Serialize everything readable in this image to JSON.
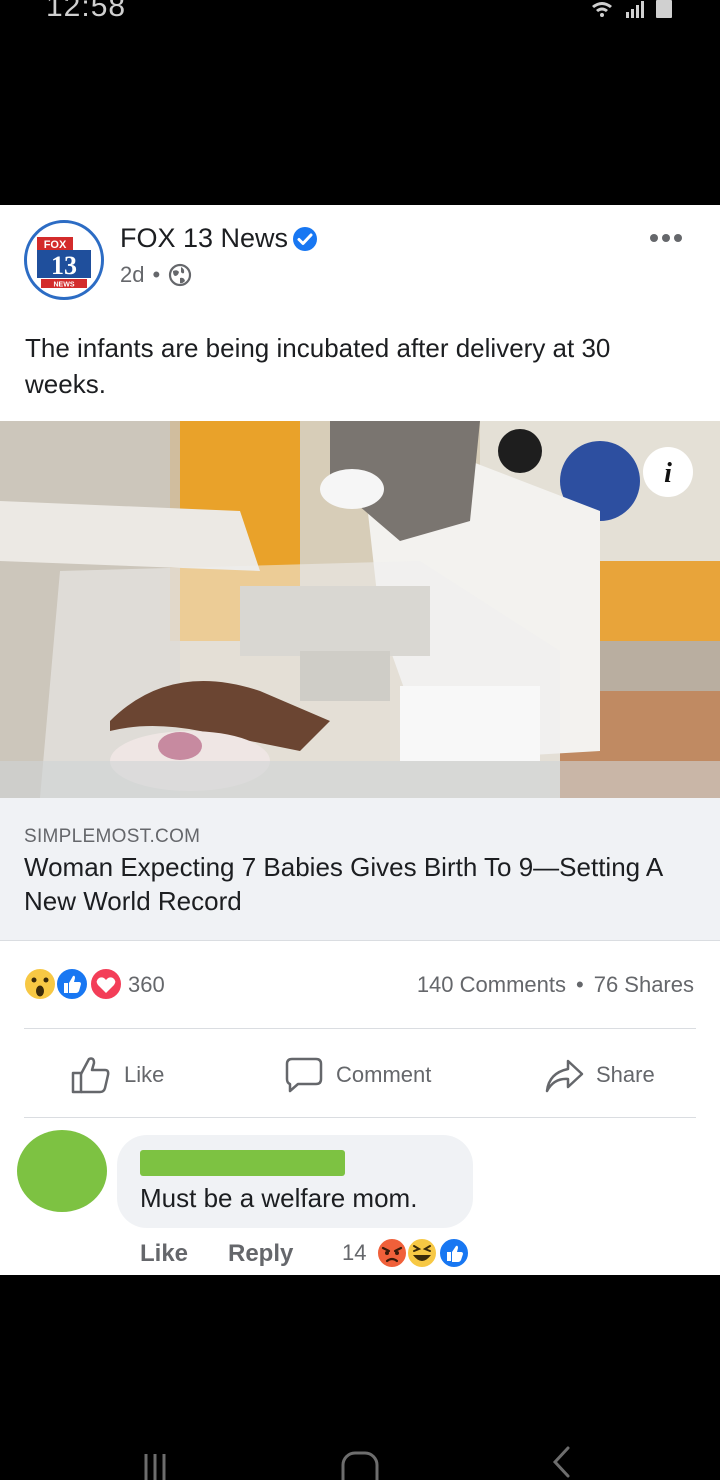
{
  "status_bar": {
    "time": "12:58"
  },
  "post": {
    "page_name": "FOX 13 News",
    "time_ago": "2d",
    "avatar_text": {
      "top": "FOX",
      "number": "13",
      "bottom": "NEWS"
    },
    "text": "The infants are being incubated after delivery at 30 weeks.",
    "link": {
      "domain": "SIMPLEMOST.COM",
      "title": "Woman Expecting 7 Babies Gives Birth To 9—Setting A New World Record"
    },
    "reaction_count": "360",
    "comments": "140 Comments",
    "shares": "76 Shares",
    "separator": "•"
  },
  "actions": {
    "like": "Like",
    "comment": "Comment",
    "share": "Share"
  },
  "comment": {
    "text": "Must be a welfare mom.",
    "like": "Like",
    "reply": "Reply",
    "reaction_count": "14"
  },
  "colors": {
    "facebook_blue": "#1877f2",
    "redaction_green": "#7dc242"
  }
}
